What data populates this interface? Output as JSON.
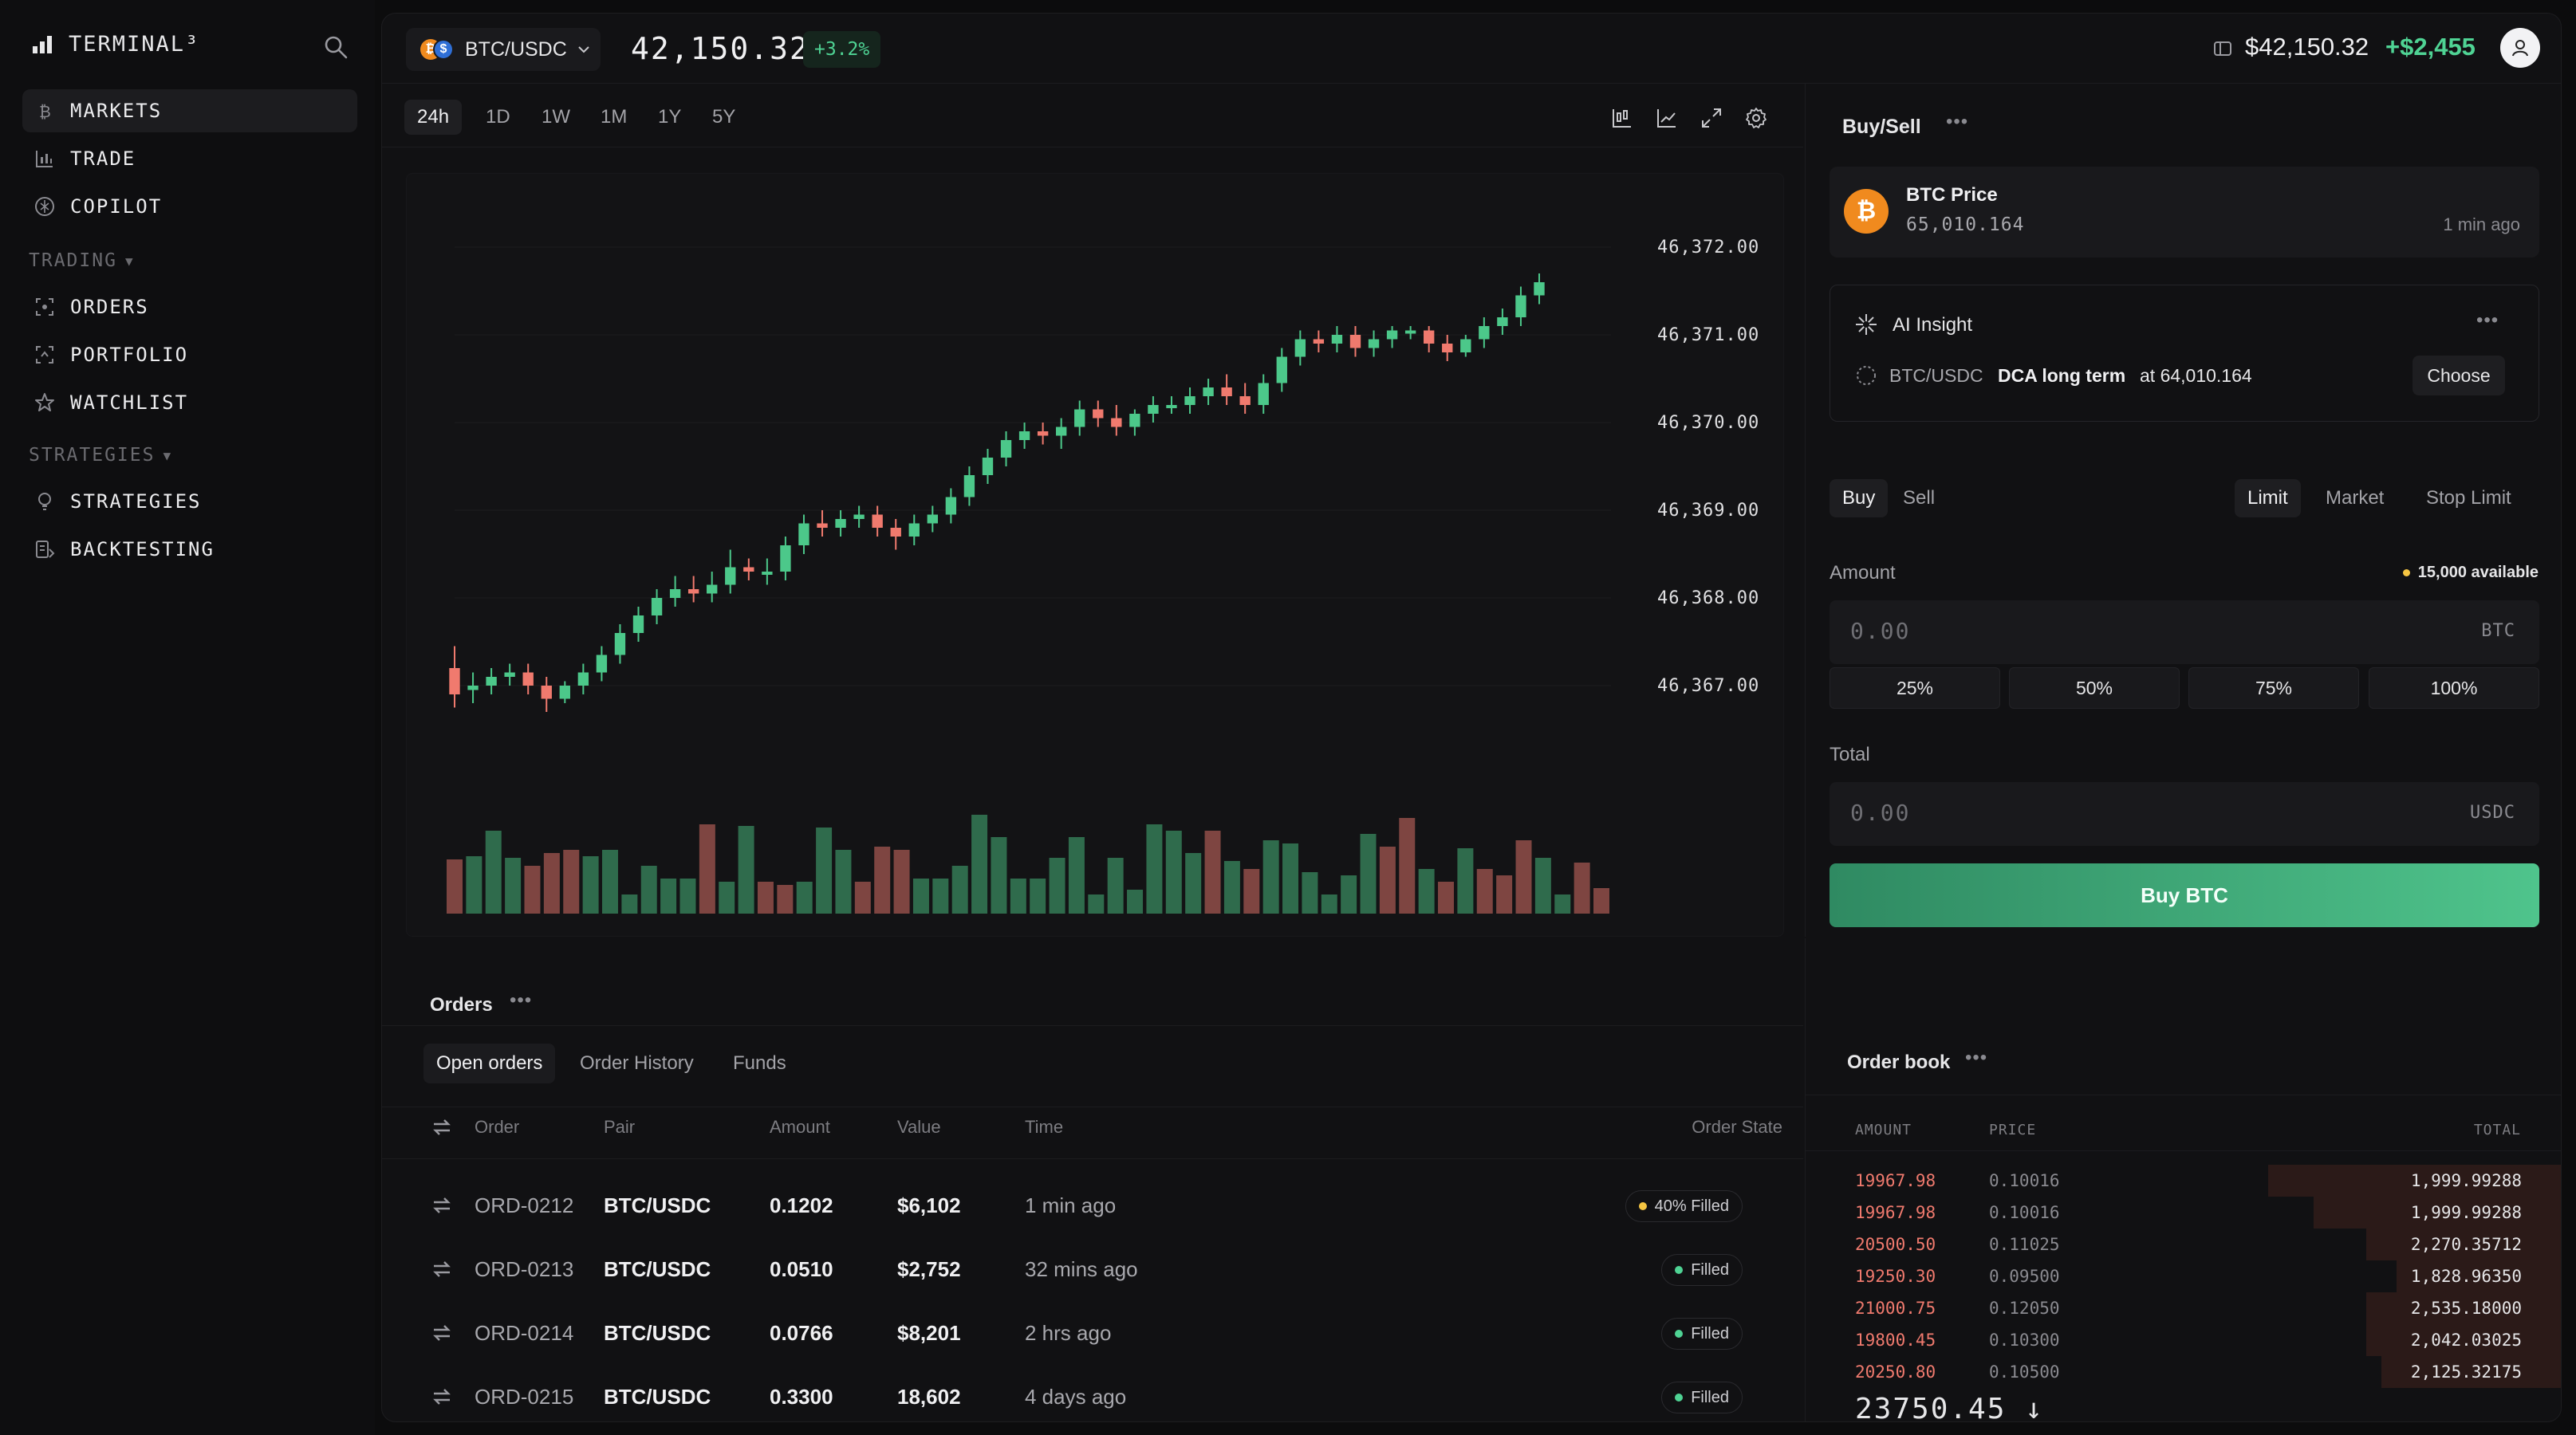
{
  "sidebar": {
    "brand": "TERMINAL³",
    "items": [
      {
        "label": "MARKETS",
        "icon": "bitcoin-icon"
      },
      {
        "label": "TRADE",
        "icon": "chart-icon"
      },
      {
        "label": "COPILOT",
        "icon": "copilot-icon"
      }
    ],
    "trading_label": "TRADING",
    "trading_items": [
      {
        "label": "ORDERS",
        "icon": "orders-icon"
      },
      {
        "label": "PORTFOLIO",
        "icon": "portfolio-icon"
      },
      {
        "label": "WATCHLIST",
        "icon": "star-icon"
      }
    ],
    "strategies_label": "STRATEGIES",
    "strategies_items": [
      {
        "label": "STRATEGIES",
        "icon": "lightbulb-icon"
      },
      {
        "label": "BACKTESTING",
        "icon": "backtest-icon"
      }
    ]
  },
  "header": {
    "pair": "BTC/USDC",
    "price": "42,150.32",
    "change": "+3.2%",
    "balance": "$42,150.32",
    "pnl": "+$2,455"
  },
  "chart_toolbar": {
    "timeframes": [
      "24h",
      "1D",
      "1W",
      "1M",
      "1Y",
      "5Y"
    ],
    "active": "24h"
  },
  "chart_data": {
    "type": "candlestick",
    "y_ticks": [
      "46,372.00",
      "46,371.00",
      "46,370.00",
      "46,369.00",
      "46,368.00",
      "46,367.00"
    ],
    "ylim": [
      46366.5,
      46372.5
    ],
    "candles": [
      {
        "o": 46367.2,
        "c": 46366.9,
        "h": 46367.45,
        "l": 46366.75
      },
      {
        "o": 46366.95,
        "c": 46367.0,
        "h": 46367.15,
        "l": 46366.8
      },
      {
        "o": 46367.0,
        "c": 46367.1,
        "h": 46367.2,
        "l": 46366.9
      },
      {
        "o": 46367.1,
        "c": 46367.15,
        "h": 46367.25,
        "l": 46367.0
      },
      {
        "o": 46367.15,
        "c": 46367.0,
        "h": 46367.25,
        "l": 46366.9
      },
      {
        "o": 46367.0,
        "c": 46366.85,
        "h": 46367.1,
        "l": 46366.7
      },
      {
        "o": 46366.85,
        "c": 46367.0,
        "h": 46367.05,
        "l": 46366.8
      },
      {
        "o": 46367.0,
        "c": 46367.15,
        "h": 46367.25,
        "l": 46366.9
      },
      {
        "o": 46367.15,
        "c": 46367.35,
        "h": 46367.45,
        "l": 46367.05
      },
      {
        "o": 46367.35,
        "c": 46367.6,
        "h": 46367.7,
        "l": 46367.25
      },
      {
        "o": 46367.6,
        "c": 46367.8,
        "h": 46367.9,
        "l": 46367.5
      },
      {
        "o": 46367.8,
        "c": 46368.0,
        "h": 46368.1,
        "l": 46367.7
      },
      {
        "o": 46368.0,
        "c": 46368.1,
        "h": 46368.25,
        "l": 46367.9
      },
      {
        "o": 46368.1,
        "c": 46368.05,
        "h": 46368.25,
        "l": 46367.95
      },
      {
        "o": 46368.05,
        "c": 46368.15,
        "h": 46368.3,
        "l": 46367.95
      },
      {
        "o": 46368.15,
        "c": 46368.35,
        "h": 46368.55,
        "l": 46368.05
      },
      {
        "o": 46368.35,
        "c": 46368.3,
        "h": 46368.45,
        "l": 46368.2
      },
      {
        "o": 46368.3,
        "c": 46368.3,
        "h": 46368.45,
        "l": 46368.15
      },
      {
        "o": 46368.3,
        "c": 46368.6,
        "h": 46368.7,
        "l": 46368.2
      },
      {
        "o": 46368.6,
        "c": 46368.85,
        "h": 46368.95,
        "l": 46368.5
      },
      {
        "o": 46368.85,
        "c": 46368.8,
        "h": 46369.0,
        "l": 46368.7
      },
      {
        "o": 46368.8,
        "c": 46368.9,
        "h": 46369.0,
        "l": 46368.7
      },
      {
        "o": 46368.9,
        "c": 46368.95,
        "h": 46369.05,
        "l": 46368.8
      },
      {
        "o": 46368.95,
        "c": 46368.8,
        "h": 46369.05,
        "l": 46368.7
      },
      {
        "o": 46368.8,
        "c": 46368.7,
        "h": 46368.9,
        "l": 46368.55
      },
      {
        "o": 46368.7,
        "c": 46368.85,
        "h": 46368.95,
        "l": 46368.6
      },
      {
        "o": 46368.85,
        "c": 46368.95,
        "h": 46369.05,
        "l": 46368.75
      },
      {
        "o": 46368.95,
        "c": 46369.15,
        "h": 46369.25,
        "l": 46368.85
      },
      {
        "o": 46369.15,
        "c": 46369.4,
        "h": 46369.5,
        "l": 46369.05
      },
      {
        "o": 46369.4,
        "c": 46369.6,
        "h": 46369.7,
        "l": 46369.3
      },
      {
        "o": 46369.6,
        "c": 46369.8,
        "h": 46369.9,
        "l": 46369.5
      },
      {
        "o": 46369.8,
        "c": 46369.9,
        "h": 46370.0,
        "l": 46369.7
      },
      {
        "o": 46369.9,
        "c": 46369.85,
        "h": 46370.0,
        "l": 46369.75
      },
      {
        "o": 46369.85,
        "c": 46369.95,
        "h": 46370.05,
        "l": 46369.7
      },
      {
        "o": 46369.95,
        "c": 46370.15,
        "h": 46370.25,
        "l": 46369.85
      },
      {
        "o": 46370.15,
        "c": 46370.05,
        "h": 46370.25,
        "l": 46369.95
      },
      {
        "o": 46370.05,
        "c": 46369.95,
        "h": 46370.2,
        "l": 46369.85
      },
      {
        "o": 46369.95,
        "c": 46370.1,
        "h": 46370.15,
        "l": 46369.85
      },
      {
        "o": 46370.1,
        "c": 46370.2,
        "h": 46370.3,
        "l": 46370.0
      },
      {
        "o": 46370.2,
        "c": 46370.2,
        "h": 46370.3,
        "l": 46370.1
      },
      {
        "o": 46370.2,
        "c": 46370.3,
        "h": 46370.4,
        "l": 46370.1
      },
      {
        "o": 46370.3,
        "c": 46370.4,
        "h": 46370.5,
        "l": 46370.2
      },
      {
        "o": 46370.4,
        "c": 46370.3,
        "h": 46370.55,
        "l": 46370.2
      },
      {
        "o": 46370.3,
        "c": 46370.2,
        "h": 46370.45,
        "l": 46370.1
      },
      {
        "o": 46370.2,
        "c": 46370.45,
        "h": 46370.55,
        "l": 46370.1
      },
      {
        "o": 46370.45,
        "c": 46370.75,
        "h": 46370.85,
        "l": 46370.35
      },
      {
        "o": 46370.75,
        "c": 46370.95,
        "h": 46371.05,
        "l": 46370.65
      },
      {
        "o": 46370.95,
        "c": 46370.9,
        "h": 46371.05,
        "l": 46370.8
      },
      {
        "o": 46370.9,
        "c": 46371.0,
        "h": 46371.1,
        "l": 46370.8
      },
      {
        "o": 46371.0,
        "c": 46370.85,
        "h": 46371.1,
        "l": 46370.75
      },
      {
        "o": 46370.85,
        "c": 46370.95,
        "h": 46371.05,
        "l": 46370.75
      },
      {
        "o": 46370.95,
        "c": 46371.05,
        "h": 46371.1,
        "l": 46370.85
      },
      {
        "o": 46371.05,
        "c": 46371.05,
        "h": 46371.1,
        "l": 46370.95
      },
      {
        "o": 46371.05,
        "c": 46370.9,
        "h": 46371.1,
        "l": 46370.8
      },
      {
        "o": 46370.9,
        "c": 46370.8,
        "h": 46371.0,
        "l": 46370.7
      },
      {
        "o": 46370.8,
        "c": 46370.95,
        "h": 46371.0,
        "l": 46370.75
      },
      {
        "o": 46370.95,
        "c": 46371.1,
        "h": 46371.2,
        "l": 46370.85
      },
      {
        "o": 46371.1,
        "c": 46371.2,
        "h": 46371.3,
        "l": 46371.0
      },
      {
        "o": 46371.2,
        "c": 46371.45,
        "h": 46371.55,
        "l": 46371.1
      },
      {
        "o": 46371.45,
        "c": 46371.6,
        "h": 46371.7,
        "l": 46371.35
      }
    ],
    "volumes": [
      {
        "v": 34,
        "up": false
      },
      {
        "v": 36,
        "up": true
      },
      {
        "v": 52,
        "up": true
      },
      {
        "v": 35,
        "up": true
      },
      {
        "v": 30,
        "up": false
      },
      {
        "v": 38,
        "up": false
      },
      {
        "v": 40,
        "up": false
      },
      {
        "v": 36,
        "up": true
      },
      {
        "v": 40,
        "up": true
      },
      {
        "v": 12,
        "up": true
      },
      {
        "v": 30,
        "up": true
      },
      {
        "v": 22,
        "up": true
      },
      {
        "v": 22,
        "up": true
      },
      {
        "v": 56,
        "up": false
      },
      {
        "v": 20,
        "up": true
      },
      {
        "v": 55,
        "up": true
      },
      {
        "v": 20,
        "up": false
      },
      {
        "v": 18,
        "up": false
      },
      {
        "v": 20,
        "up": true
      },
      {
        "v": 54,
        "up": true
      },
      {
        "v": 40,
        "up": true
      },
      {
        "v": 20,
        "up": false
      },
      {
        "v": 42,
        "up": false
      },
      {
        "v": 40,
        "up": false
      },
      {
        "v": 22,
        "up": true
      },
      {
        "v": 22,
        "up": true
      },
      {
        "v": 30,
        "up": true
      },
      {
        "v": 62,
        "up": true
      },
      {
        "v": 48,
        "up": true
      },
      {
        "v": 22,
        "up": true
      },
      {
        "v": 22,
        "up": true
      },
      {
        "v": 35,
        "up": true
      },
      {
        "v": 48,
        "up": true
      },
      {
        "v": 12,
        "up": true
      },
      {
        "v": 35,
        "up": true
      },
      {
        "v": 15,
        "up": true
      },
      {
        "v": 56,
        "up": true
      },
      {
        "v": 52,
        "up": true
      },
      {
        "v": 38,
        "up": true
      },
      {
        "v": 52,
        "up": false
      },
      {
        "v": 33,
        "up": true
      },
      {
        "v": 28,
        "up": false
      },
      {
        "v": 46,
        "up": true
      },
      {
        "v": 44,
        "up": true
      },
      {
        "v": 26,
        "up": true
      },
      {
        "v": 12,
        "up": true
      },
      {
        "v": 24,
        "up": true
      },
      {
        "v": 50,
        "up": true
      },
      {
        "v": 42,
        "up": false
      },
      {
        "v": 60,
        "up": false
      },
      {
        "v": 28,
        "up": true
      },
      {
        "v": 20,
        "up": false
      },
      {
        "v": 41,
        "up": true
      },
      {
        "v": 28,
        "up": false
      },
      {
        "v": 24,
        "up": false
      },
      {
        "v": 46,
        "up": false
      },
      {
        "v": 35,
        "up": true
      },
      {
        "v": 12,
        "up": true
      },
      {
        "v": 32,
        "up": false
      },
      {
        "v": 16,
        "up": false
      }
    ]
  },
  "buy_panel": {
    "title": "Buy/Sell",
    "price_title": "BTC Price",
    "price_value": "65,010.164",
    "price_time": "1 min ago",
    "insight_title": "AI Insight",
    "insight_pair": "BTC/USDC",
    "insight_strategy": "DCA long term",
    "insight_at": "at 64,010.164",
    "choose": "Choose",
    "sides": [
      "Buy",
      "Sell"
    ],
    "order_types": [
      "Limit",
      "Market",
      "Stop Limit"
    ],
    "amount_label": "Amount",
    "available": "15,000 available",
    "amount_placeholder": "0.00",
    "amount_unit": "BTC",
    "percents": [
      "25%",
      "50%",
      "75%",
      "100%"
    ],
    "total_label": "Total",
    "total_placeholder": "0.00",
    "total_unit": "USDC",
    "buy_button": "Buy BTC"
  },
  "orders": {
    "title": "Orders",
    "tabs": [
      "Open orders",
      "Order History",
      "Funds"
    ],
    "columns": [
      "Order",
      "Pair",
      "Amount",
      "Value",
      "Time",
      "Order State"
    ],
    "rows": [
      {
        "id": "ORD-0212",
        "pair": "BTC/USDC",
        "amount": "0.1202",
        "value": "$6,102",
        "time": "1 min ago",
        "state": "40% Filled",
        "dot": "#f5c542"
      },
      {
        "id": "ORD-0213",
        "pair": "BTC/USDC",
        "amount": "0.0510",
        "value": "$2,752",
        "time": "32 mins ago",
        "state": "Filled",
        "dot": "#4fd394"
      },
      {
        "id": "ORD-0214",
        "pair": "BTC/USDC",
        "amount": "0.0766",
        "value": "$8,201",
        "time": "2 hrs ago",
        "state": "Filled",
        "dot": "#4fd394"
      },
      {
        "id": "ORD-0215",
        "pair": "BTC/USDC",
        "amount": "0.3300",
        "value": "18,602",
        "time": "4 days ago",
        "state": "Filled",
        "dot": "#4fd394"
      }
    ]
  },
  "order_book": {
    "title": "Order book",
    "columns": [
      "AMOUNT",
      "PRICE",
      "TOTAL"
    ],
    "rows": [
      {
        "amount": "19967.98",
        "price": "0.10016",
        "total": "1,999.99288",
        "depth": 0.39
      },
      {
        "amount": "19967.98",
        "price": "0.10016",
        "total": "1,999.99288",
        "depth": 0.33
      },
      {
        "amount": "20500.50",
        "price": "0.11025",
        "total": "2,270.35712",
        "depth": 0.26
      },
      {
        "amount": "19250.30",
        "price": "0.09500",
        "total": "1,828.96350",
        "depth": 0.22
      },
      {
        "amount": "21000.75",
        "price": "0.12050",
        "total": "2,535.18000",
        "depth": 0.26
      },
      {
        "amount": "19800.45",
        "price": "0.10300",
        "total": "2,042.03025",
        "depth": 0.26
      },
      {
        "amount": "20250.80",
        "price": "0.10500",
        "total": "2,125.32175",
        "depth": 0.24
      }
    ],
    "last": "23750.45"
  },
  "colors": {
    "up": "#4cc88a",
    "down": "#f07a6e",
    "vol_up": "#2f6b4c",
    "vol_down": "#7e4541",
    "accent": "#4fd394"
  }
}
